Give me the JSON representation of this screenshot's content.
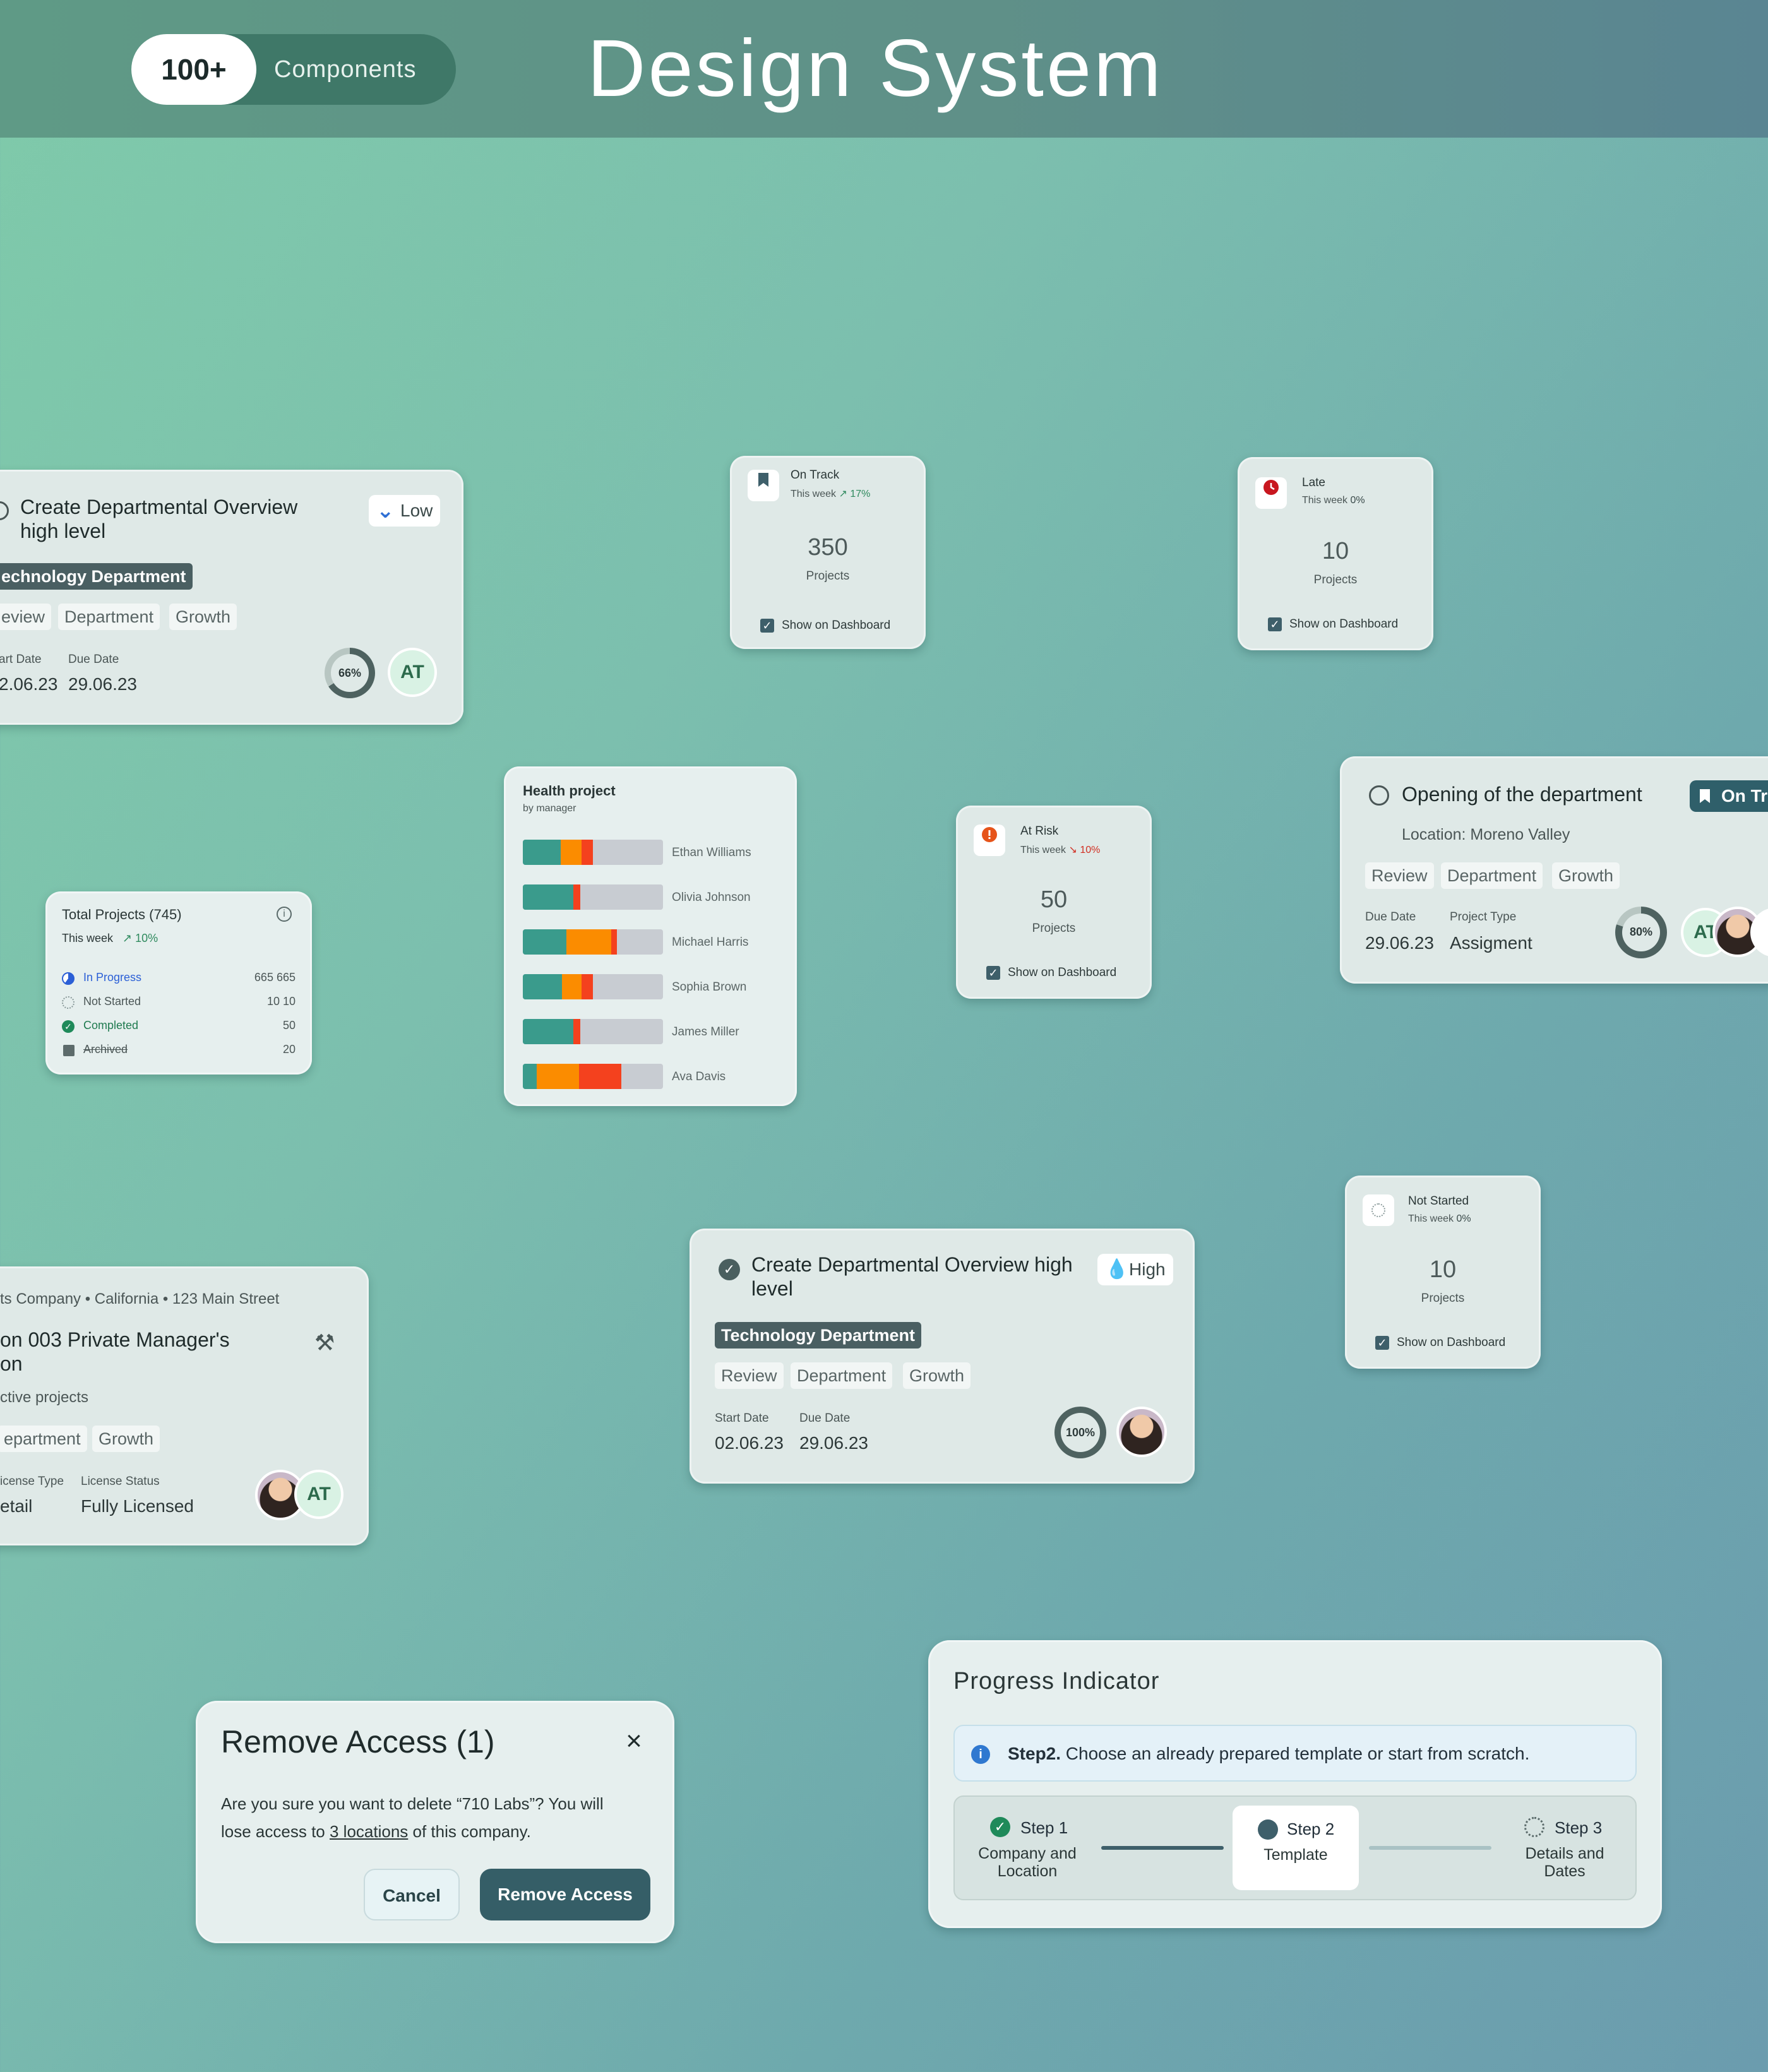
{
  "header": {
    "count": "100+",
    "count_label": "Components",
    "title": "Design System"
  },
  "task_card_1": {
    "title": "Create Departmental Overview high level",
    "priority": "Low",
    "department": "echnology Department",
    "tags": [
      "eview",
      "Department",
      "Growth"
    ],
    "start_label": "art Date",
    "start_value": "2.06.23",
    "due_label": "Due Date",
    "due_value": "29.06.23",
    "progress": "66%",
    "avatar": "AT"
  },
  "stat_on_track": {
    "label": "On Track",
    "period": "This week",
    "delta": "17%",
    "value": "350",
    "unit": "Projects",
    "checkbox_label": "Show on Dashboard"
  },
  "stat_late": {
    "label": "Late",
    "period": "This week",
    "delta": "0%",
    "value": "10",
    "unit": "Projects",
    "checkbox_label": "Show on Dashboard"
  },
  "health": {
    "title": "Health project",
    "subtitle": "by manager",
    "rows": [
      {
        "name": "Ethan Williams",
        "green": 0.27,
        "orange": 0.15,
        "red": 0.08
      },
      {
        "name": "Olivia Johnson",
        "green": 0.36,
        "orange": 0.0,
        "red": 0.05
      },
      {
        "name": "Michael Harris",
        "green": 0.31,
        "orange": 0.32,
        "red": 0.04
      },
      {
        "name": "Sophia Brown",
        "green": 0.28,
        "orange": 0.14,
        "red": 0.08
      },
      {
        "name": "James Miller",
        "green": 0.36,
        "orange": 0.0,
        "red": 0.05
      },
      {
        "name": "Ava Davis",
        "green": 0.1,
        "orange": 0.3,
        "red": 0.3
      }
    ]
  },
  "total_projects": {
    "title": "Total Projects (745)",
    "period": "This week",
    "delta": "10%",
    "rows": [
      {
        "label": "In Progress",
        "value": "665 665"
      },
      {
        "label": "Not Started",
        "value": "10 10"
      },
      {
        "label": "Completed",
        "value": "50"
      },
      {
        "label": "Archived",
        "value": "20"
      }
    ]
  },
  "stat_at_risk": {
    "label": "At Risk",
    "period": "This week",
    "delta": "10%",
    "value": "50",
    "unit": "Projects",
    "checkbox_label": "Show on Dashboard"
  },
  "opening_card": {
    "title": "Opening of the department",
    "status": "On Tr",
    "location": "Location: Moreno Valley",
    "tags": [
      "Review",
      "Department",
      "Growth"
    ],
    "due_label": "Due Date",
    "due_value": "29.06.23",
    "type_label": "Project Type",
    "type_value": "Assigment",
    "progress": "80%",
    "avatar": "AT"
  },
  "stat_not_started": {
    "label": "Not Started",
    "period": "This week",
    "delta": "0%",
    "value": "10",
    "unit": "Projects",
    "checkbox_label": "Show on Dashboard"
  },
  "company_card": {
    "address": "ts Company • California • 123 Main Street",
    "title_line1": "on 003 Private Manager's",
    "title_line2": "on",
    "subtitle": "ctive projects",
    "tags": [
      "epartment",
      "Growth"
    ],
    "license_type_label": "icense Type",
    "license_type_value": "etail",
    "license_status_label": "License Status",
    "license_status_value": "Fully Licensed",
    "avatar": "AT"
  },
  "task_card_2": {
    "title": "Create Departmental Overview high level",
    "priority": "High",
    "department": "Technology Department",
    "tags": [
      "Review",
      "Department",
      "Growth"
    ],
    "start_label": "Start Date",
    "start_value": "02.06.23",
    "due_label": "Due Date",
    "due_value": "29.06.23",
    "progress": "100%"
  },
  "dialog": {
    "title": "Remove Access (1)",
    "body_1": "Are you sure you want to delete “710 Labs”? You will",
    "body_2a": "lose access to ",
    "body_link": "3 locations",
    "body_2b": " of this company.",
    "cancel": "Cancel",
    "confirm": "Remove Access"
  },
  "progress_indicator": {
    "title": "Progress Indicator",
    "info_strong": "Step2.",
    "info_text": " Choose an already prepared template or start from scratch.",
    "steps": [
      {
        "label": "Step 1",
        "desc_1": "Company and",
        "desc_2": "Location"
      },
      {
        "label": "Step 2",
        "desc_1": "Template",
        "desc_2": ""
      },
      {
        "label": "Step 3",
        "desc_1": "Details and",
        "desc_2": "Dates"
      }
    ]
  },
  "colors": {
    "teal": "#3a9b8c",
    "orange": "#fb8c00",
    "red": "#f4411e",
    "slate": "#3e5f6a"
  }
}
